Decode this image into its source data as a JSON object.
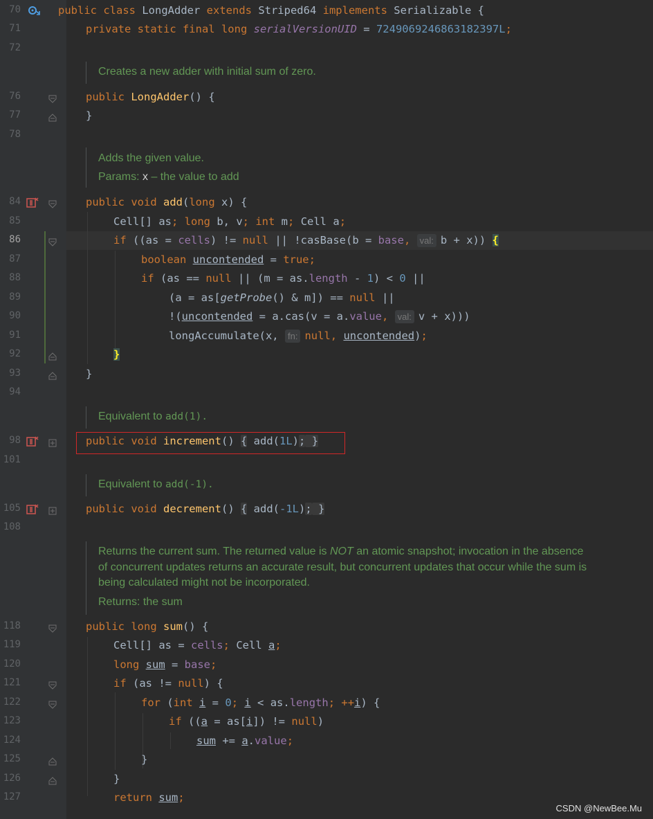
{
  "line_numbers": {
    "l70": "70",
    "l71": "71",
    "l72": "72",
    "l76": "76",
    "l77": "77",
    "l78": "78",
    "l84": "84",
    "l85": "85",
    "l86": "86",
    "l87": "87",
    "l88": "88",
    "l89": "89",
    "l90": "90",
    "l91": "91",
    "l92": "92",
    "l93": "93",
    "l94": "94",
    "l98": "98",
    "l101": "101",
    "l105": "105",
    "l108": "108",
    "l118": "118",
    "l119": "119",
    "l120": "120",
    "l121": "121",
    "l122": "122",
    "l123": "123",
    "l124": "124",
    "l125": "125",
    "l126": "126",
    "l127": "127"
  },
  "code": {
    "l70": {
      "k1": "public class ",
      "cls": "LongAdder ",
      "k2": "extends ",
      "sup": "Striped64 ",
      "k3": "implements ",
      "iface": "Serializable {"
    },
    "l71": {
      "k": "private static final long ",
      "f": "serialVersionUID",
      " eq": " = ",
      "n": "7249069246863182397L",
      "semi": ";"
    },
    "l76": {
      "k": "public ",
      "fn": "LongAdder",
      "rest": "() {"
    },
    "l77": {
      "t": "}"
    },
    "l84": {
      "k": "public void ",
      "fn": "add",
      "p1": "(",
      "k2": "long ",
      "p2": "x) {"
    },
    "l85": {
      "a": "Cell[] as",
      "s1": "; ",
      "k1": "long ",
      "b": "b, v",
      "s2": "; ",
      "k2": "int ",
      "c": "m",
      "s3": "; ",
      "d": "Cell a",
      "s4": ";"
    },
    "l86": {
      "k": "if ",
      "a": "((as = ",
      "f": "cells",
      ") ": ") != ",
      "kn": "null",
      " ||": " || !casBase(b = ",
      "f2": "base",
      ",": ", ",
      "hint": "val:",
      "rest": "b + x)) ",
      "br": "{"
    },
    "l87": {
      "k": "boolean ",
      "u": "uncontended",
      " =": " = ",
      "k2": "true",
      "semi": ";"
    },
    "l88": {
      "k": "if ",
      "a": "(as == ",
      "kn": "null",
      " ||": " || (m = as.",
      "f": "length",
      " -": " - ",
      "n1": "1",
      ")": ") < ",
      "n2": "0",
      " e": " ||"
    },
    "l89": {
      "a": "(a = as[",
      "m": "getProbe",
      "b": "() & m]) == ",
      "kn": "null",
      " e": " ||"
    },
    "l90": {
      "a": "!(",
      "u": "uncontended",
      " =": " = a.cas(v = a.",
      "f": "value",
      ",": ", ",
      "hint": "val:",
      "rest": "v + x)))"
    },
    "l91": {
      "a": "longAccumulate(x, ",
      "hint": "fn:",
      "kn": "null",
      ",": ", ",
      "u": "uncontended",
      ")": ")",
      "semi": ";"
    },
    "l92": {
      "br": "}"
    },
    "l93": {
      "t": "}"
    },
    "l98": {
      "k": "public void ",
      "fn": "increment",
      "p": "() ",
      "o": "{",
      "body1": " add(",
      "n": "1L",
      "body2": ")",
      "semi": ";",
      "c": " }"
    },
    "l105": {
      "k": "public void ",
      "fn": "decrement",
      "p": "() ",
      "o": "{",
      "body1": " add(",
      "n": "-1L",
      "body2": ")",
      "semi": ";",
      "c": " }"
    },
    "l118": {
      "k": "public long ",
      "fn": "sum",
      "rest": "() {"
    },
    "l119": {
      "a": "Cell[] as = ",
      "f": "cells",
      "semi": "; ",
      "b": "Cell ",
      "u": "a",
      "s2": ";"
    },
    "l120": {
      "k": "long ",
      "u": "sum",
      " =": " = ",
      "f": "base",
      "semi": ";"
    },
    "l121": {
      "k": "if ",
      "a": "(as != ",
      "kn": "null",
      "rest": ") {"
    },
    "l122": {
      "k": "for ",
      "a": "(",
      "k2": "int ",
      "u1": "i",
      " =": " = ",
      "n": "0",
      "s1": "; ",
      "u2": "i",
      " <": " < as.",
      "f": "length",
      "s2": "; ++",
      "u3": "i",
      "rest": ") {"
    },
    "l123": {
      "k": "if ",
      "a": "((",
      "u1": "a",
      " =": " = as[",
      "u2": "i",
      "b": "]) != ",
      "kn": "null",
      "rest": ")"
    },
    "l124": {
      "u1": "sum",
      " +=": " += ",
      "u2": "a",
      ".": ".",
      "f": "value",
      "semi": ";"
    },
    "l125": {
      "t": "}"
    },
    "l126": {
      "t": "}"
    },
    "l127": {
      "k": "return ",
      "u": "sum",
      "semi": ";"
    }
  },
  "docs": {
    "d1": "Creates a new adder with initial sum of zero.",
    "d2a": "Adds the given value.",
    "d2b_label": "Params: ",
    "d2b_param": "x",
    "d2b_text": " – the value to add",
    "d3_text": "Equivalent to ",
    "d3_code": "add(1).",
    "d4_text": "Equivalent to ",
    "d4_code": "add(-1).",
    "d5_l1a": "Returns the current sum. The returned value is ",
    "d5_l1em": "NOT",
    "d5_l1b": " an atomic snapshot; invocation in the absence",
    "d5_l2": "of concurrent updates returns an accurate result, but concurrent updates that occur while the sum is",
    "d5_l3": "being calculated might not be incorporated.",
    "d5_ret": "Returns: the sum"
  },
  "watermark": "CSDN @NewBee.Mu",
  "colors": {
    "keyword": "#cc7832",
    "number": "#6897bb",
    "method_decl": "#ffc66d",
    "field": "#9876aa",
    "doc": "#629755",
    "highlight_box": "#d22828"
  }
}
